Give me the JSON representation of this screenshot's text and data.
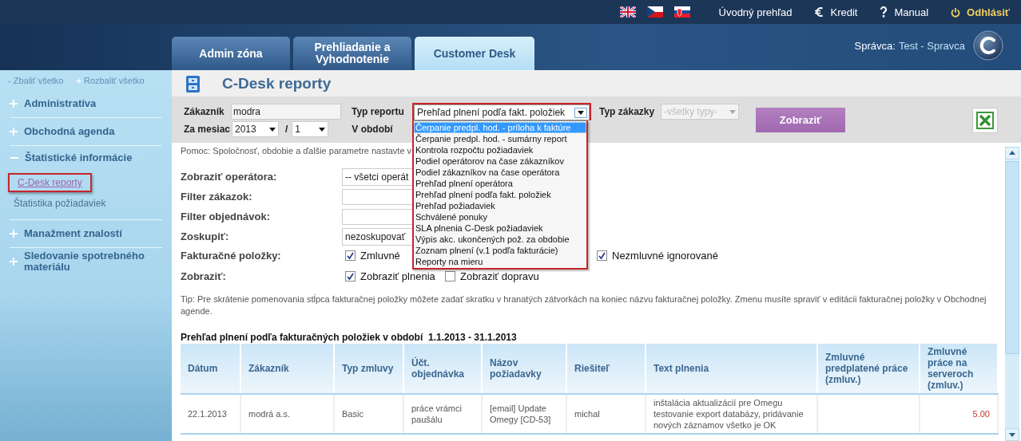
{
  "top_links": [
    {
      "kind": "plain",
      "label": "Úvodný prehľad"
    },
    {
      "kind": "euro",
      "label": "Kredit"
    },
    {
      "kind": "help",
      "label": "Manual"
    },
    {
      "kind": "logout",
      "label": "Odhlásiť"
    }
  ],
  "tabs": [
    {
      "label": "Admin zóna",
      "selected": false
    },
    {
      "label": "Prehliadanie a Vyhodnotenie",
      "selected": false
    },
    {
      "label": "Customer Desk",
      "selected": true
    }
  ],
  "user": {
    "label": "Správca:",
    "name": "Test - Spravca"
  },
  "sidebar": {
    "actions": [
      {
        "kind": "collapse",
        "sign": "-",
        "label": "Zbaliť všetko"
      },
      {
        "kind": "expand",
        "sign": "+",
        "label": "Rozbaliť všetko"
      }
    ],
    "items": [
      {
        "label": "Administratíva",
        "expanded": false
      },
      {
        "label": "Obchodná agenda",
        "expanded": false
      },
      {
        "label": "Štatistické informácie",
        "expanded": true,
        "children": [
          {
            "label": "C-Desk reporty",
            "selected": true
          },
          {
            "label": "Štatistika požiadaviek",
            "selected": false
          }
        ]
      },
      {
        "label": "Manažment znalostí",
        "expanded": false
      },
      {
        "label": "Sledovanie spotrebného materiálu",
        "expanded": false
      }
    ]
  },
  "page": {
    "title": "C-Desk reporty"
  },
  "filters": {
    "customer_label": "Zákazník",
    "customer_value": "modra",
    "month_label": "Za mesiac",
    "year": "2013",
    "separator": "/",
    "month": "1",
    "period_label": "V období",
    "report_type_label": "Typ reportu",
    "report_type_value": "Prehľad plnení podľa fakt. položiek",
    "report_type_options": [
      {
        "label": "Čerpanie predpl. hod. - príloha k faktúre",
        "selected": true
      },
      {
        "label": "Čerpanie predpl. hod. - sumárny report",
        "selected": false
      },
      {
        "label": "Kontrola rozpočtu požiadaviek",
        "selected": false
      },
      {
        "label": "Podiel operátorov na čase zákazníkov",
        "selected": false
      },
      {
        "label": "Podiel zákazníkov na čase operátora",
        "selected": false
      },
      {
        "label": "Prehľad plnení operátora",
        "selected": false
      },
      {
        "label": "Prehľad plnení podľa fakt. položiek",
        "selected": false
      },
      {
        "label": "Prehľad požiadaviek",
        "selected": false
      },
      {
        "label": "Schválené ponuky",
        "selected": false
      },
      {
        "label": "SLA plnenia C-Desk požiadaviek",
        "selected": false
      },
      {
        "label": "Výpis akc. ukončených pož. za obdobie",
        "selected": false
      },
      {
        "label": "Zoznam plnení (v.1 podľa fakturácie)",
        "selected": false
      },
      {
        "label": "Reporty na mieru",
        "selected": false
      }
    ],
    "contract_type_label": "Typ zákazky",
    "contract_type_value": "-všetky typy-",
    "contract_type_disabled": true,
    "submit": "Zobraziť"
  },
  "help": "Pomoc: Spoločnosť, obdobie a ďalšie parametre nastavte v",
  "form": [
    {
      "kind": "select",
      "label": "Zobraziť operátora:",
      "value": "-- všetci operát"
    },
    {
      "kind": "text",
      "label": "Filter zákazok:"
    },
    {
      "kind": "text",
      "label": "Filter objednávok:"
    },
    {
      "kind": "select",
      "label": "Zoskupiť:",
      "value": "nezoskupovať"
    },
    {
      "kind": "checks",
      "label": "Fakturačné položky:",
      "options": [
        {
          "label": "Zmluvné",
          "checked": true
        },
        {
          "label": "Nezmluvné ignorované",
          "checked": true
        }
      ]
    },
    {
      "kind": "checks",
      "label": "Zobraziť:",
      "options": [
        {
          "label": "Zobraziť plnenia",
          "checked": true
        },
        {
          "label": "Zobraziť dopravu",
          "checked": false
        }
      ]
    }
  ],
  "tip": "Tip: Pre skrátenie pomenovania stĺpca fakturačnej položky môžete zadať skratku v hranatých zátvorkách na koniec názvu fakturačnej položky. Zmenu musíte spraviť v editácii fakturačnej položky v Obchodnej agende.",
  "table": {
    "title": "Prehľad plnení podľa fakturačných položiek v období  1.1.2013 - 31.1.2013",
    "columns": [
      {
        "label": "Dátum",
        "kind": "text"
      },
      {
        "label": "Zákazník",
        "kind": "text"
      },
      {
        "label": "Typ zmluvy",
        "kind": "text"
      },
      {
        "label": "Účt. objednávka",
        "kind": "text"
      },
      {
        "label": "Názov požiadavky",
        "kind": "text"
      },
      {
        "label": "Riešiteľ",
        "kind": "text"
      },
      {
        "label": "Text plnenia",
        "kind": "text"
      },
      {
        "label": "Zmluvné predplatené práce (zmluv.)",
        "kind": "number"
      },
      {
        "label": "Zmluvné práce na serveroch (zmluv.)",
        "kind": "number"
      }
    ],
    "rows": [
      [
        "22.1.2013",
        "modrá a.s.",
        "Basic",
        "práce vrámci paušálu",
        "[email] Update Omegy [CD-53]",
        "michal",
        "inštalácia aktualizácií pre Omegu testovanie export databázy, pridávanie nových záznamov všetko je OK",
        null,
        "5.00"
      ]
    ]
  }
}
